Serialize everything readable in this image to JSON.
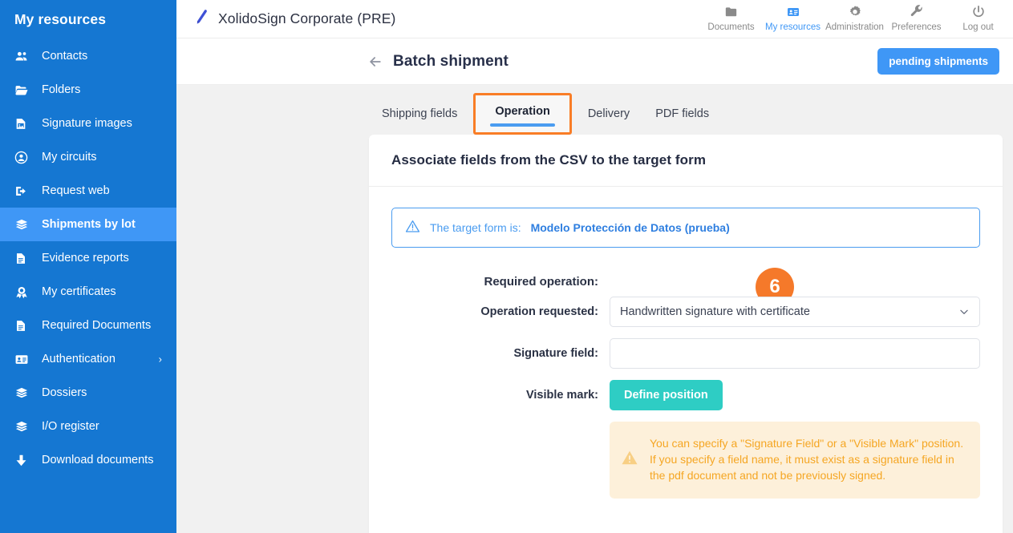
{
  "sidebar": {
    "title": "My resources",
    "items": [
      {
        "label": "Contacts",
        "icon": "users-icon",
        "active": false,
        "chevron": false
      },
      {
        "label": "Folders",
        "icon": "folder-open-icon",
        "active": false,
        "chevron": false
      },
      {
        "label": "Signature images",
        "icon": "image-file-icon",
        "active": false,
        "chevron": false
      },
      {
        "label": "My circuits",
        "icon": "circle-user-icon",
        "active": false,
        "chevron": false
      },
      {
        "label": "Request web",
        "icon": "sign-out-icon",
        "active": false,
        "chevron": false
      },
      {
        "label": "Shipments by lot",
        "icon": "layers-icon",
        "active": true,
        "chevron": false
      },
      {
        "label": "Evidence reports",
        "icon": "file-lines-icon",
        "active": false,
        "chevron": false
      },
      {
        "label": "My certificates",
        "icon": "certificate-icon",
        "active": false,
        "chevron": false
      },
      {
        "label": "Required Documents",
        "icon": "file-lines-icon",
        "active": false,
        "chevron": false
      },
      {
        "label": "Authentication",
        "icon": "id-card-icon",
        "active": false,
        "chevron": true
      },
      {
        "label": "Dossiers",
        "icon": "layers-icon",
        "active": false,
        "chevron": false
      },
      {
        "label": "I/O register",
        "icon": "layers-icon",
        "active": false,
        "chevron": false
      },
      {
        "label": "Download documents",
        "icon": "download-icon",
        "active": false,
        "chevron": false
      }
    ],
    "chevron_glyph": "›",
    "background_color": "#1577d2",
    "active_color": "#3f97f6"
  },
  "topbar": {
    "brand_name": "XolidoSign Corporate (PRE)",
    "brand_icon": "pen-icon",
    "nav": [
      {
        "label": "Documents",
        "icon": "folder-icon",
        "active": false
      },
      {
        "label": "My resources",
        "icon": "id-card-icon",
        "active": true
      },
      {
        "label": "Administration",
        "icon": "gear-icon",
        "active": false
      },
      {
        "label": "Preferences",
        "icon": "wrench-icon",
        "active": false
      },
      {
        "label": "Log out",
        "icon": "power-icon",
        "active": false
      }
    ]
  },
  "pagebar": {
    "back_icon": "arrow-left-icon",
    "title": "Batch shipment",
    "pending_button": "pending shipments",
    "pending_button_color": "#3f97f6"
  },
  "tabs": [
    {
      "label": "Shipping fields",
      "selected": false
    },
    {
      "label": "Operation",
      "selected": true
    },
    {
      "label": "Delivery",
      "selected": false
    },
    {
      "label": "PDF fields",
      "selected": false
    }
  ],
  "tab_highlight_color": "#f97d26",
  "tab_underline_color": "#4a9cf0",
  "card": {
    "heading": "Associate fields from the CSV to the target form",
    "info_banner": {
      "icon": "warning-triangle-icon",
      "text": "The target form is:",
      "target_form": "Modelo Protección de Datos (prueba)",
      "color": "#4a9cf0"
    },
    "form": {
      "required_operation_label": "Required operation:",
      "step_badge": "6",
      "step_badge_color": "#f5792a",
      "operation_requested_label": "Operation requested:",
      "operation_requested_value": "Handwritten signature with certificate",
      "operation_requested_options": [
        "Handwritten signature with certificate"
      ],
      "dropdown_icon": "chevron-down-icon",
      "signature_field_label": "Signature field:",
      "signature_field_value": "",
      "signature_field_placeholder": "",
      "visible_mark_label": "Visible mark:",
      "define_position_button": "Define position",
      "define_position_color": "#2ecdc4",
      "warning": {
        "icon": "warning-triangle-icon",
        "text": "You can specify a \"Signature Field\" or a \"Visible Mark\" position. If you specify a field name, it must exist as a signature field in the pdf document and not be previously signed.",
        "color": "#f5a623",
        "background": "#fdf0da"
      }
    }
  }
}
